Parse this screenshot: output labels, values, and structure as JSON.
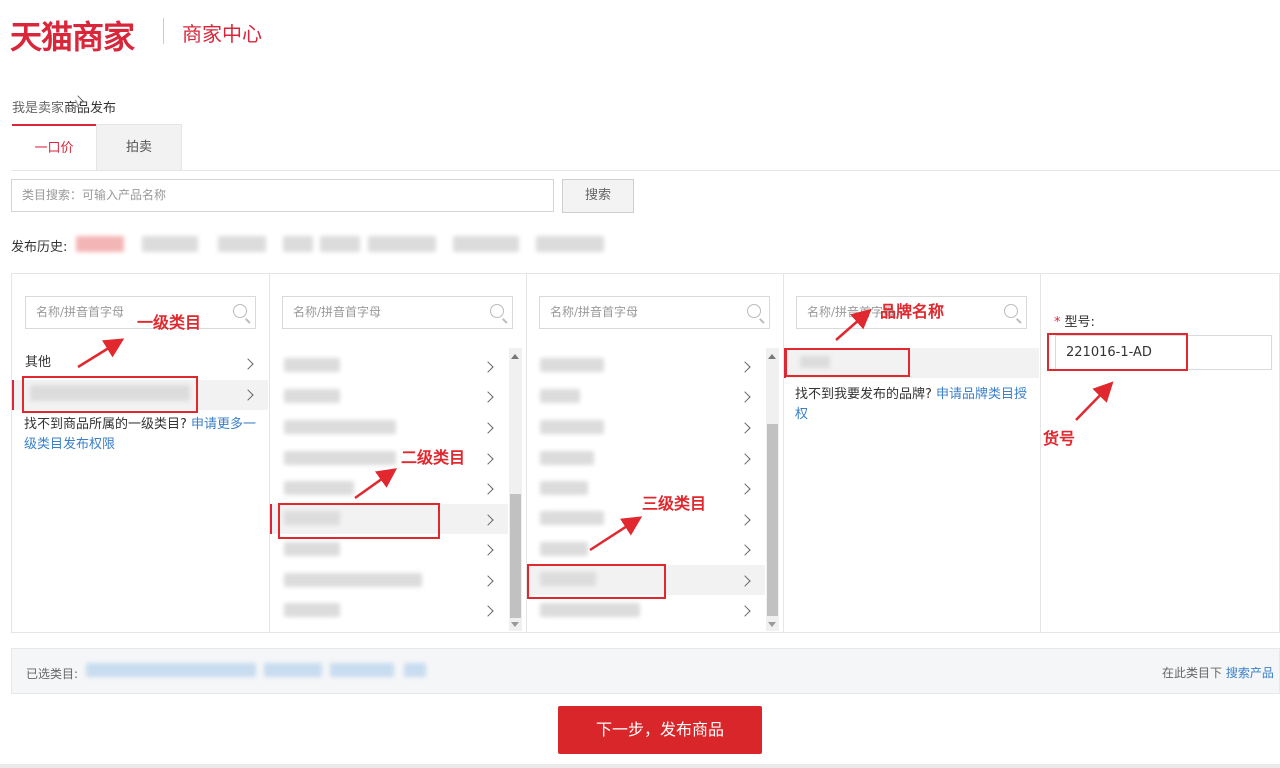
{
  "header": {
    "brand": "天猫商家",
    "center": "商家中心"
  },
  "breadcrumb": {
    "root": "我是卖家",
    "current": "商品发布"
  },
  "tabs": [
    {
      "label": "一口价",
      "active": true
    },
    {
      "label": "拍卖",
      "active": false
    }
  ],
  "category_search": {
    "placeholder": "类目搜索：可输入产品名称",
    "button": "搜索"
  },
  "history": {
    "label": "发布历史:"
  },
  "columns": {
    "filter_placeholder": "名称/拼音首字母",
    "col1": {
      "items": [
        "其他"
      ],
      "note_text": "找不到商品所属的一级类目?",
      "note_link": "申请更多一级类目发布权限"
    },
    "col4": {
      "note_text": "找不到我要发布的品牌?",
      "note_link": "申请品牌类目授权"
    }
  },
  "model_field": {
    "required_mark": "*",
    "label": "型号:",
    "value": "221016-1-AD"
  },
  "annotations": {
    "level1": "一级类目",
    "level2": "二级类目",
    "level3": "三级类目",
    "brand": "品牌名称",
    "item_no": "货号"
  },
  "selected_bar": {
    "label": "已选类目:",
    "search_prefix": "在此类目下",
    "search_link": "搜索产品"
  },
  "next_button": "下一步，发布商品",
  "colors": {
    "brand_red": "#d9263b",
    "annotation_red": "#e0282e",
    "link_blue": "#3a7fc7"
  }
}
